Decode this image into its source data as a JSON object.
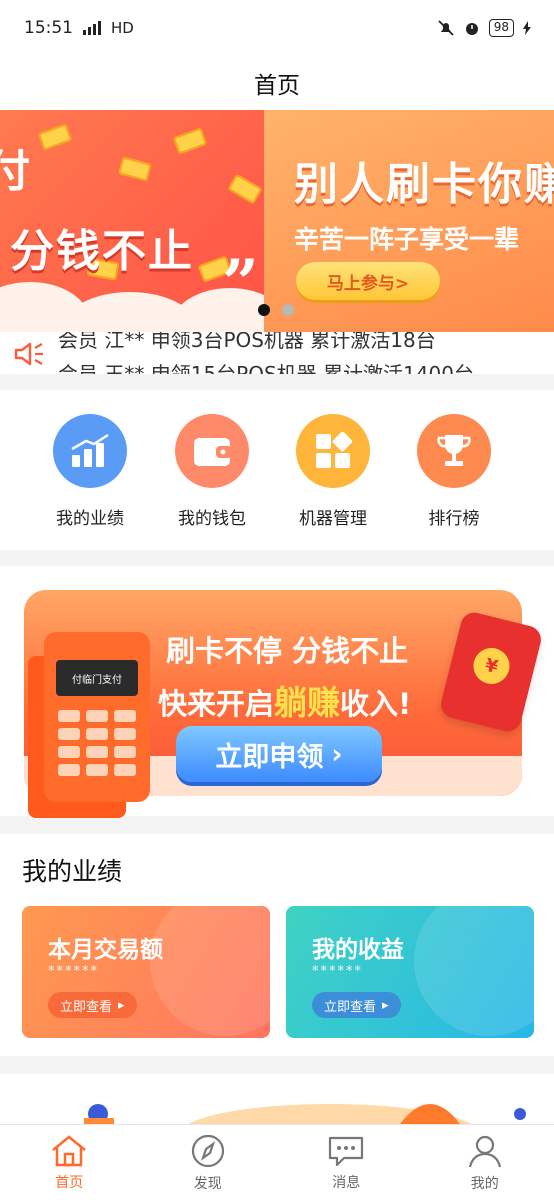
{
  "status_bar": {
    "time": "15:51",
    "network": "4G",
    "hd": "HD",
    "battery": "98"
  },
  "header": {
    "title": "首页"
  },
  "banner": {
    "slide_a": {
      "edge_text": "付",
      "title": "分钱不止"
    },
    "slide_b": {
      "headline": "别人刷卡你赚",
      "subline": "辛苦一阵子享受一辈",
      "cta": "马上参与>"
    },
    "active_index": 0,
    "count": 2
  },
  "marquee": {
    "line1": "会员 江** 申领3台POS机器 累计激活18台",
    "line2": "会员 王** 申领15台POS机器 累计激活1400台"
  },
  "quick_entries": [
    {
      "label": "我的业绩",
      "icon": "bar-chart-icon",
      "color": "#5a9cf5"
    },
    {
      "label": "我的钱包",
      "icon": "wallet-icon",
      "color": "#ff8a6a"
    },
    {
      "label": "机器管理",
      "icon": "grid-apps-icon",
      "color": "#ffb43a"
    },
    {
      "label": "排行榜",
      "icon": "trophy-icon",
      "color": "#ff8a50"
    }
  ],
  "promo": {
    "line1": "刷卡不停 分钱不止",
    "line2_pre": "快来开启",
    "line2_hl": "躺赚",
    "line2_post": "收入!",
    "button": "立即申领",
    "pos_label": "付临门支付"
  },
  "performance": {
    "title": "我的业绩",
    "cards": [
      {
        "name": "本月交易额",
        "value": "******",
        "action": "立即查看"
      },
      {
        "name": "我的收益",
        "value": "******",
        "action": "立即查看"
      }
    ]
  },
  "tabbar": [
    {
      "label": "首页",
      "icon": "home-icon"
    },
    {
      "label": "发现",
      "icon": "compass-icon"
    },
    {
      "label": "消息",
      "icon": "message-icon"
    },
    {
      "label": "我的",
      "icon": "user-icon"
    }
  ],
  "colors": {
    "accent": "#ff6a2b",
    "tab_inactive": "#666666"
  }
}
